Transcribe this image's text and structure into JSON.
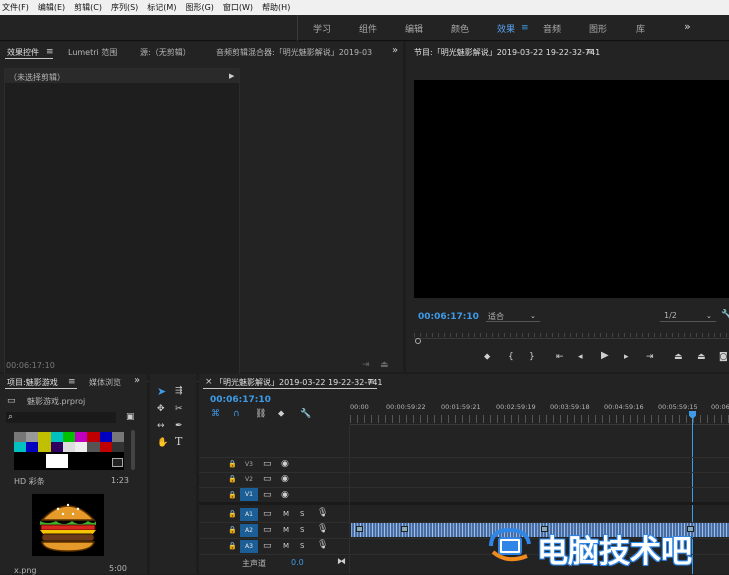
{
  "menu": [
    "文件(F)",
    "编辑(E)",
    "剪辑(C)",
    "序列(S)",
    "标记(M)",
    "图形(G)",
    "窗口(W)",
    "帮助(H)"
  ],
  "workspaces": [
    {
      "label": "学习",
      "active": false
    },
    {
      "label": "组件",
      "active": false
    },
    {
      "label": "编辑",
      "active": false
    },
    {
      "label": "颜色",
      "active": false
    },
    {
      "label": "效果",
      "active": true
    },
    {
      "label": "音频",
      "active": false
    },
    {
      "label": "图形",
      "active": false
    },
    {
      "label": "库",
      "active": false
    }
  ],
  "source_panel": {
    "tabs": [
      "效果控件",
      "Lumetri 范围",
      "源:（无剪辑）",
      "音频剪辑混合器:「明光魅影解说」2019-03"
    ],
    "no_clip": "（未选择剪辑）",
    "timecode": "00:06:17:10"
  },
  "program_panel": {
    "title": "节目:「明光魅影解说」2019-03-22 19-22-32-741",
    "timecode": "00:06:17:10",
    "fit": "适合",
    "resolution": "1/2"
  },
  "project_panel": {
    "tab": "项目:魅影游戏",
    "tab2": "媒体浏览",
    "file": "魅影游戏.prproj",
    "items": [
      {
        "name": "HD 彩条",
        "duration": "1:23"
      },
      {
        "name": "x.png",
        "duration": "5:00"
      }
    ]
  },
  "timeline": {
    "title": "「明光魅影解说」2019-03-22 19-22-32-741",
    "timecode": "00:06:17:10",
    "ruler": [
      "00:00",
      "00:00:59:22",
      "00:01:59:21",
      "00:02:59:19",
      "00:03:59:18",
      "00:04:59:16",
      "00:05:59:15",
      "00:06"
    ],
    "video_tracks": [
      "V3",
      "V2",
      "V1"
    ],
    "audio_tracks": [
      "A1",
      "A2",
      "A3"
    ],
    "master_label": "主声道",
    "master_value": "0.0"
  },
  "watermark": "电脑技术吧",
  "colors": {
    "accent": "#3d9be9",
    "panel": "#232323",
    "bg": "#1d1d1d",
    "audio_clip": "#4a6fa5"
  }
}
